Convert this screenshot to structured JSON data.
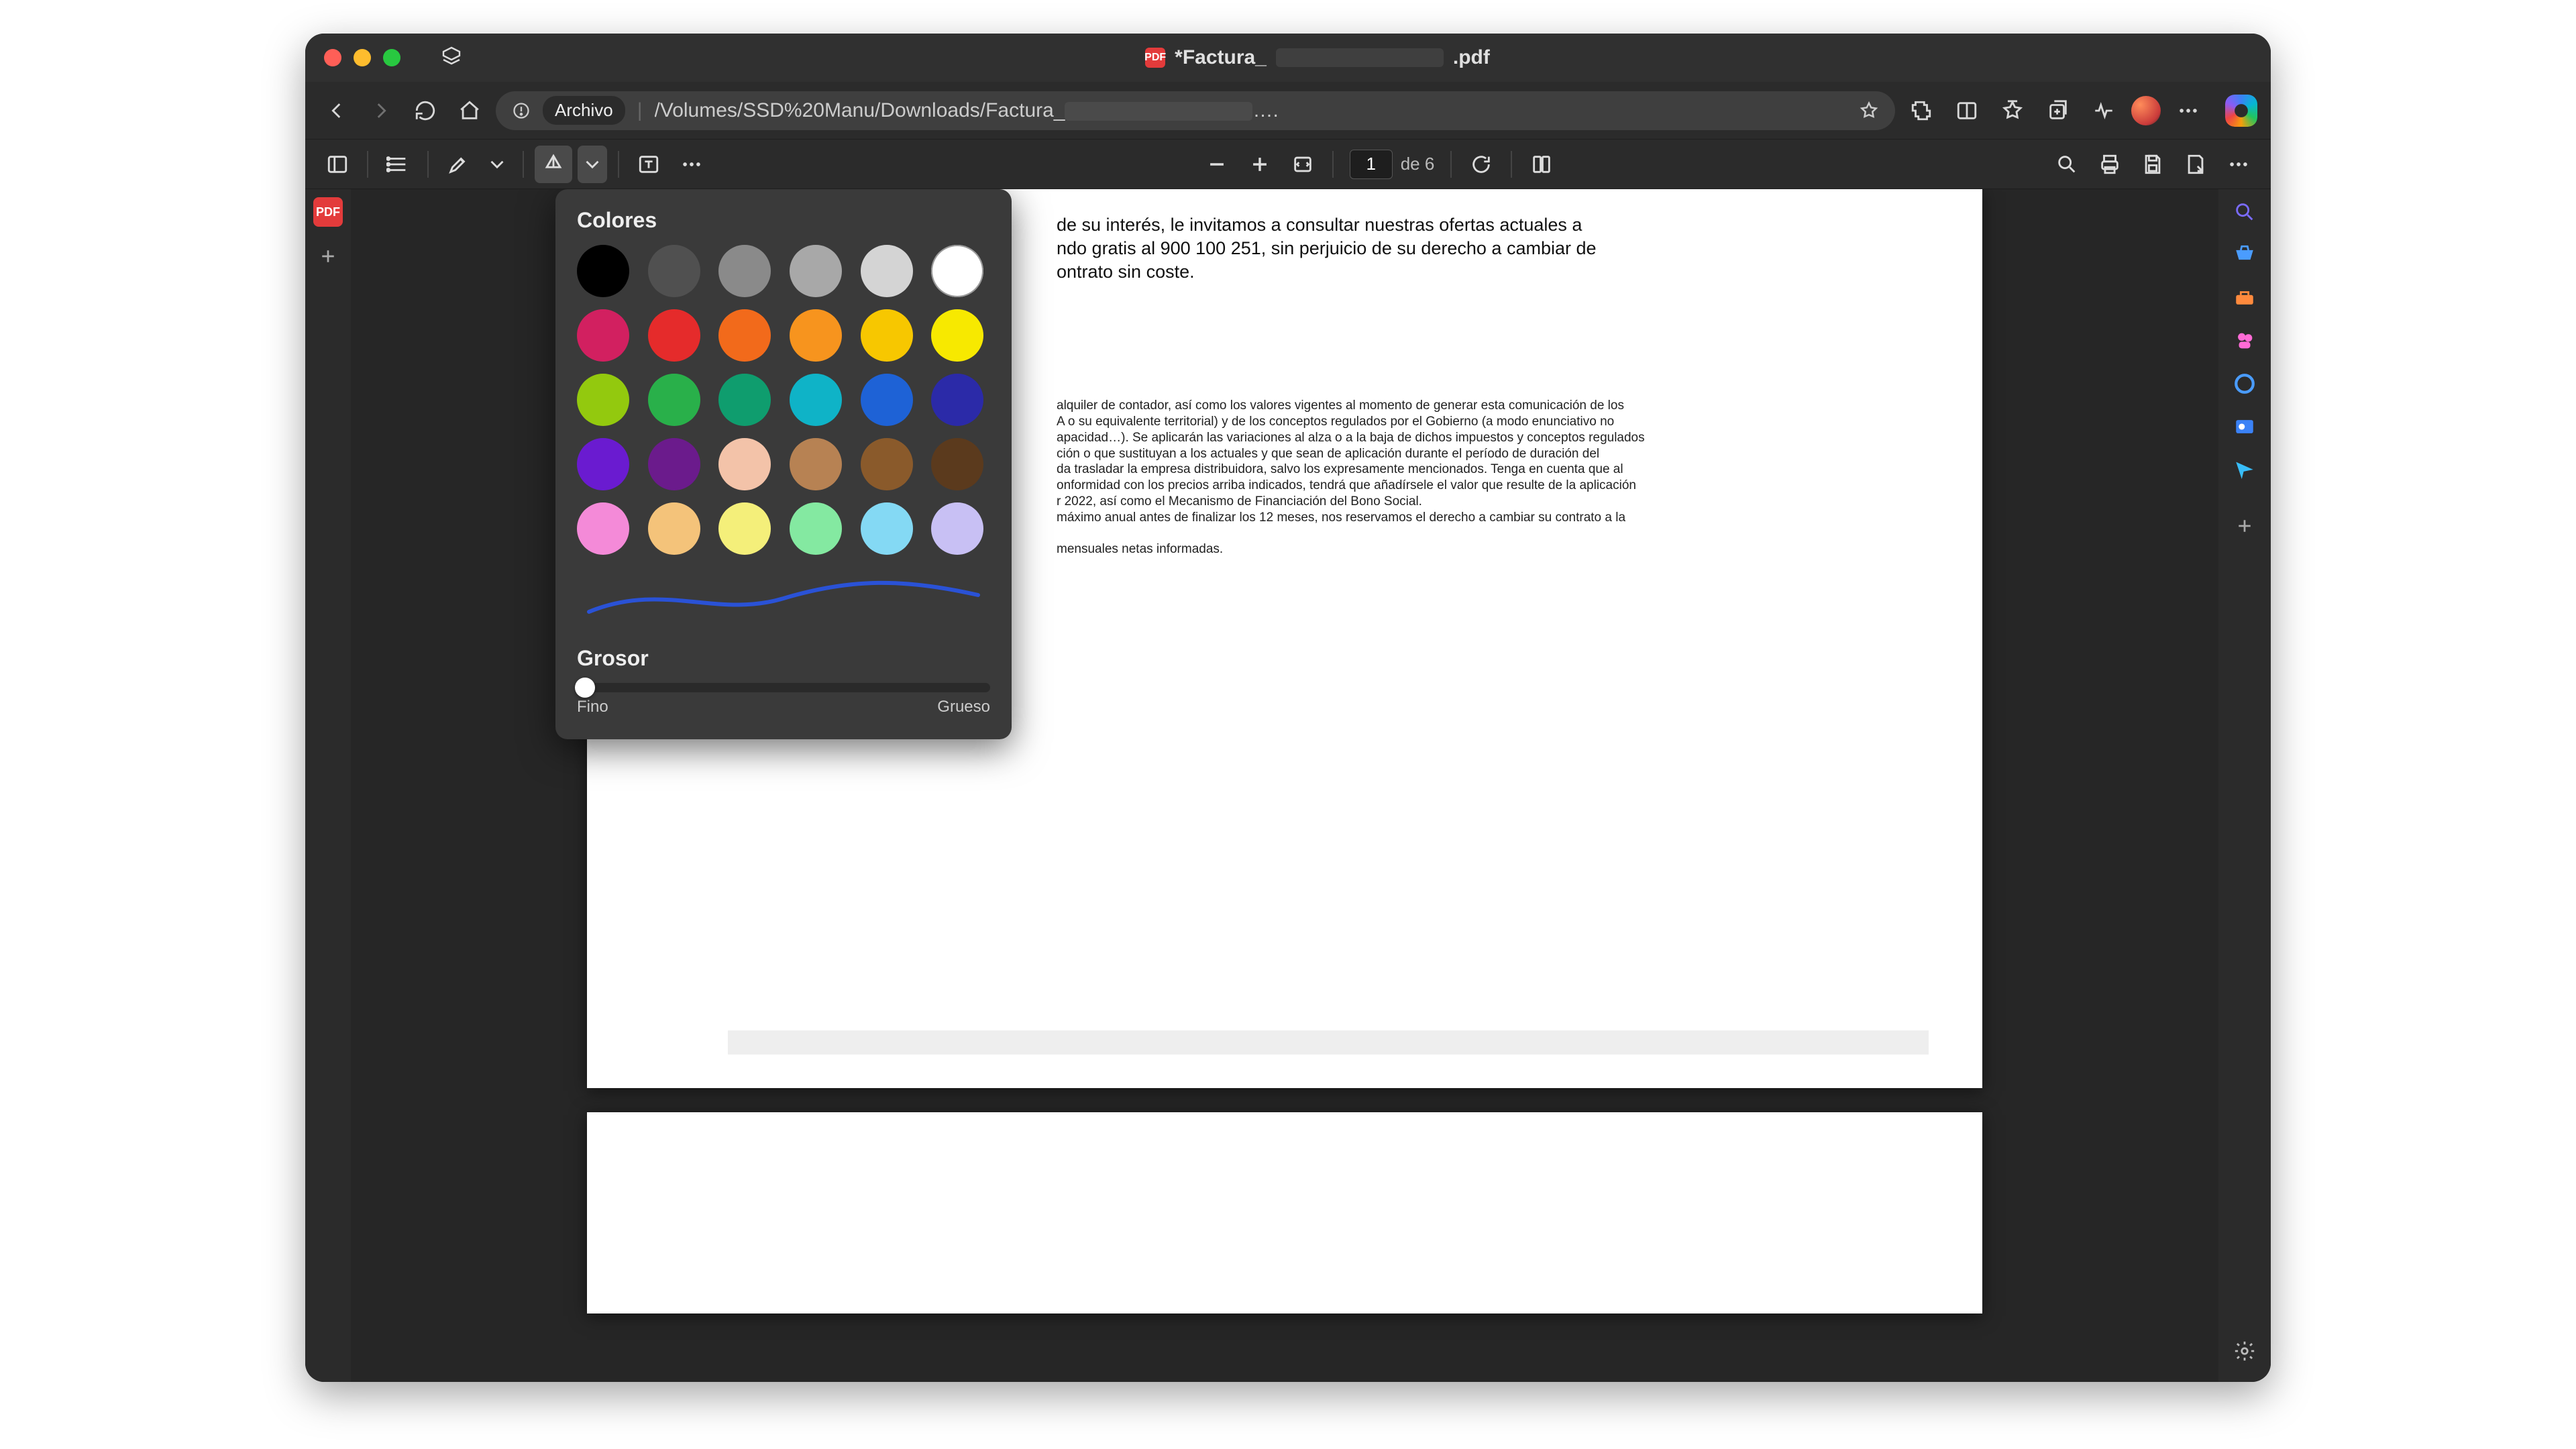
{
  "window": {
    "title_prefix": "*Factura_",
    "title_suffix": ".pdf"
  },
  "address": {
    "scheme_label": "Archivo",
    "path_prefix": "/Volumes/SSD%20Manu/Downloads/Factura_",
    "path_ellipsis": "…."
  },
  "pdf_toolbar": {
    "page_current": "1",
    "page_total_label": "de 6"
  },
  "popover": {
    "colors_label": "Colores",
    "thickness_label": "Grosor",
    "thin_label": "Fino",
    "thick_label": "Grueso",
    "preview_color": "#2a52d6",
    "swatches": [
      [
        "#000000",
        "#505050",
        "#8a8a8a",
        "#a8a8a8",
        "#d4d4d4",
        "#ffffff"
      ],
      [
        "#d22060",
        "#e52b2b",
        "#f26a1b",
        "#f7941e",
        "#f7c700",
        "#f7e900"
      ],
      [
        "#93c90e",
        "#29b04a",
        "#0f9d6e",
        "#0fb3c7",
        "#1e62d6",
        "#2b2aa8"
      ],
      [
        "#6a1bd0",
        "#6b1b8c",
        "#f3c3a9",
        "#b78253",
        "#8a5a2b",
        "#5b3a1d"
      ],
      [
        "#f48ad8",
        "#f4c37a",
        "#f4ef7a",
        "#84e9a1",
        "#84d9f4",
        "#c8c0f4"
      ]
    ]
  },
  "document": {
    "para_top_a": "de su interés, le invitamos a consultar nuestras ofertas actuales a",
    "para_top_b": "ndo gratis al 900 100 251, sin perjuicio de su derecho a cambiar de",
    "para_top_c": "ontrato sin coste.",
    "fine_1": "alquiler de contador, así como los valores vigentes al momento de generar esta comunicación de los",
    "fine_2": "A o su equivalente territorial) y de los conceptos regulados por el Gobierno (a modo enunciativo no",
    "fine_3": "apacidad…). Se aplicarán las variaciones al alza o a la baja de dichos impuestos y conceptos regulados",
    "fine_4": "ción o que sustituyan a los actuales y que sean de aplicación durante el período de duración del",
    "fine_5": "da trasladar la empresa distribuidora, salvo los expresamente mencionados. Tenga en cuenta que al",
    "fine_6": "onformidad con los precios arriba indicados, tendrá que añadírsele el valor que resulte de la aplicación",
    "fine_7": "r 2022, así como el Mecanismo de Financiación del Bono Social.",
    "fine_8": "máximo anual antes de finalizar los 12 meses, nos reservamos el derecho a cambiar su contrato a la",
    "fine_9": "mensuales netas informadas."
  }
}
